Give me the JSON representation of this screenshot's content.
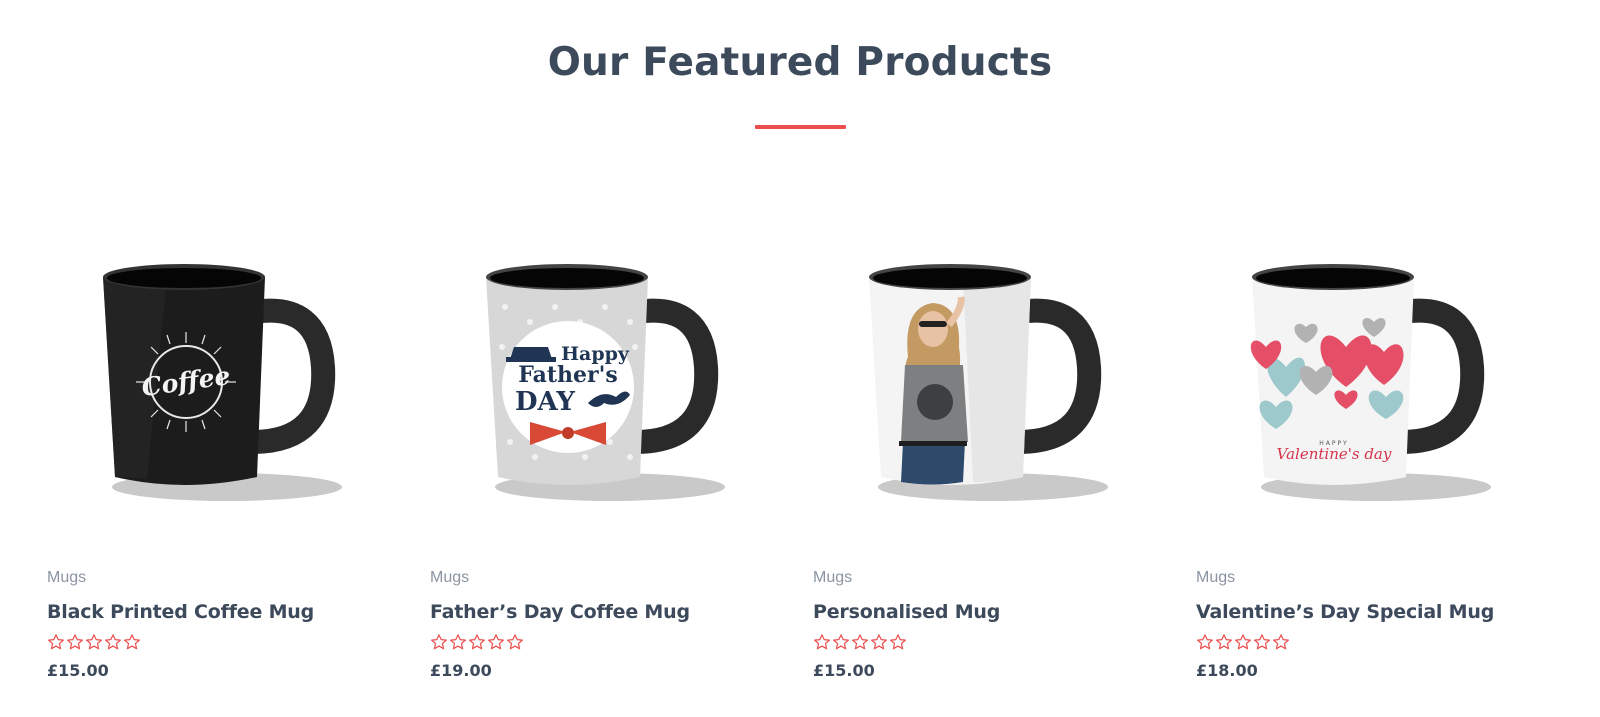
{
  "section": {
    "title": "Our Featured Products",
    "accent_color": "#ec4e4e"
  },
  "products": [
    {
      "image_icon": "black-coffee-mug-image",
      "mug_print_text": "Coffee",
      "category": "Mugs",
      "name": "Black Printed Coffee Mug",
      "rating": 0,
      "price": "£15.00"
    },
    {
      "image_icon": "fathers-day-mug-image",
      "mug_print_text": [
        "Happy",
        "Father's",
        "DAY"
      ],
      "category": "Mugs",
      "name": "Father’s Day Coffee Mug",
      "rating": 0,
      "price": "£19.00"
    },
    {
      "image_icon": "personalised-photo-mug-image",
      "category": "Mugs",
      "name": "Personalised Mug",
      "rating": 0,
      "price": "£15.00"
    },
    {
      "image_icon": "valentines-hearts-mug-image",
      "mug_print_text": [
        "HAPPY",
        "Valentine's day"
      ],
      "category": "Mugs",
      "name": "Valentine’s Day Special Mug",
      "rating": 0,
      "price": "£18.00"
    }
  ]
}
